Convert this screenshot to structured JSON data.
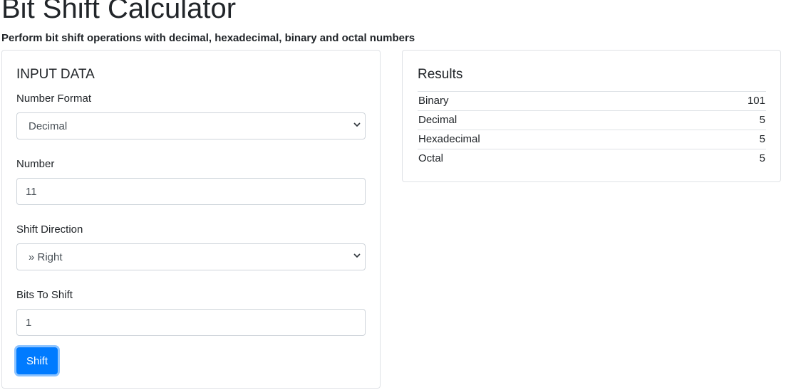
{
  "page": {
    "title": "Bit Shift Calculator",
    "subtitle": "Perform bit shift operations with decimal, hexadecimal, binary and octal numbers"
  },
  "input": {
    "heading": "INPUT DATA",
    "number_format_label": "Number Format",
    "number_format_value": "Decimal",
    "number_label": "Number",
    "number_value": "11",
    "shift_direction_label": "Shift Direction",
    "shift_direction_value": "» Right",
    "bits_label": "Bits To Shift",
    "bits_value": "1",
    "shift_button": "Shift"
  },
  "results": {
    "heading": "Results",
    "rows": [
      {
        "label": "Binary",
        "value": "101"
      },
      {
        "label": "Decimal",
        "value": "5"
      },
      {
        "label": "Hexadecimal",
        "value": "5"
      },
      {
        "label": "Octal",
        "value": "5"
      }
    ]
  },
  "colors": {
    "accent": "#007bff",
    "border": "#dfe2e6",
    "text": "#212529"
  }
}
